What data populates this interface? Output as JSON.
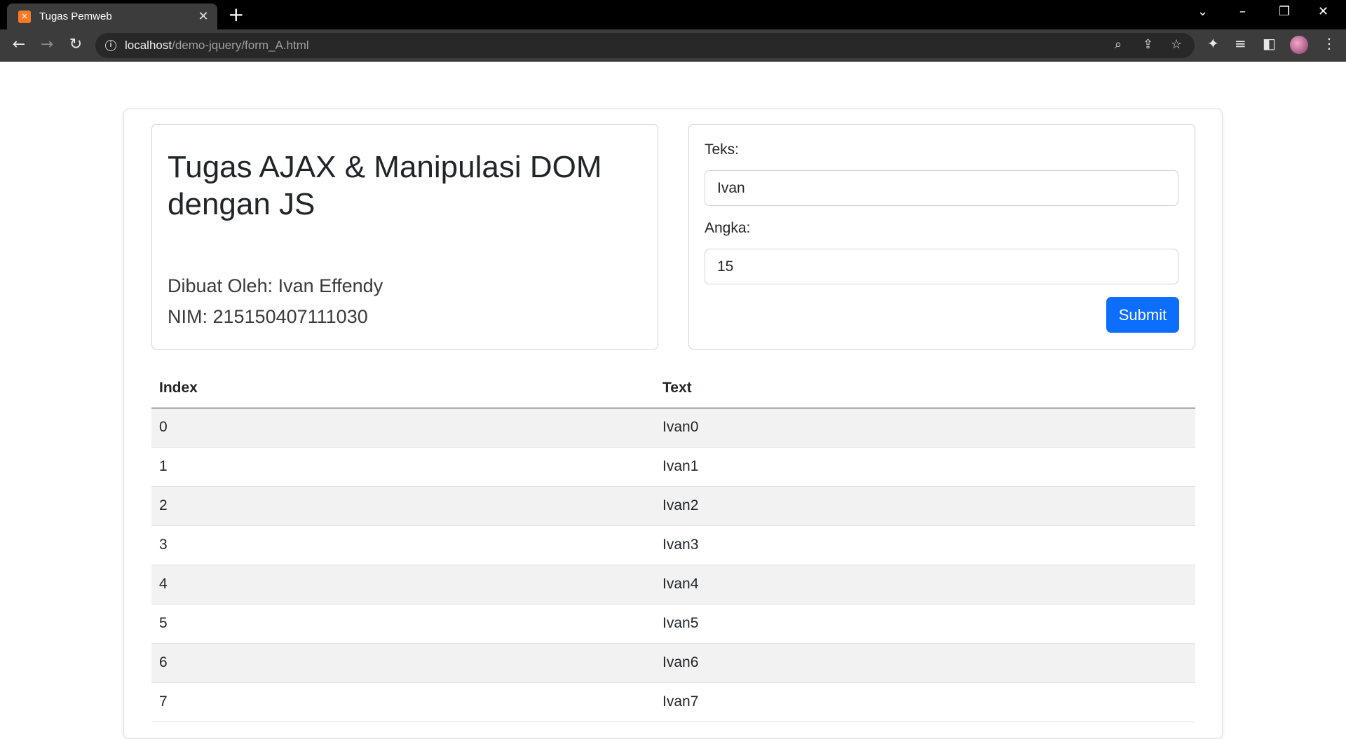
{
  "browser": {
    "tab_title": "Tugas Pemweb",
    "tab_favicon": "xampp-icon",
    "url_host": "localhost",
    "url_path": "/demo-jquery/form_A.html"
  },
  "header": {
    "title": "Tugas AJAX & Manipulasi DOM dengan JS",
    "author": "Dibuat Oleh: Ivan Effendy",
    "nim": "NIM: 215150407111030"
  },
  "form": {
    "teks_label": "Teks:",
    "teks_value": "Ivan",
    "angka_label": "Angka:",
    "angka_value": "15",
    "submit_label": "Submit"
  },
  "table": {
    "headers": [
      "Index",
      "Text"
    ],
    "rows": [
      [
        "0",
        "Ivan0"
      ],
      [
        "1",
        "Ivan1"
      ],
      [
        "2",
        "Ivan2"
      ],
      [
        "3",
        "Ivan3"
      ],
      [
        "4",
        "Ivan4"
      ],
      [
        "5",
        "Ivan5"
      ],
      [
        "6",
        "Ivan6"
      ],
      [
        "7",
        "Ivan7"
      ]
    ]
  },
  "colors": {
    "primary": "#0d6efd",
    "stripe": "#f2f2f2"
  }
}
